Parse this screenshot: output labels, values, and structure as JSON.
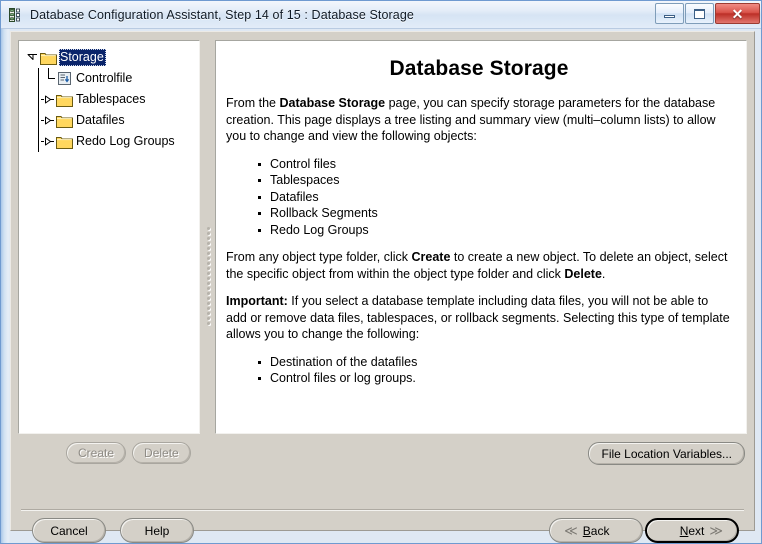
{
  "window": {
    "title": "Database Configuration Assistant, Step 14 of 15 : Database Storage",
    "icon": "database-icon",
    "controls": {
      "minimize": "minimize-icon",
      "maximize": "maximize-icon",
      "close": "✕"
    }
  },
  "tree": {
    "nodes": [
      {
        "label": "Storage",
        "icon": "folder-icon",
        "state": "expanded",
        "selected": true
      },
      {
        "label": "Controlfile",
        "icon": "controlfile-icon",
        "state": "leaf",
        "selected": false
      },
      {
        "label": "Tablespaces",
        "icon": "folder-icon",
        "state": "collapsed",
        "selected": false
      },
      {
        "label": "Datafiles",
        "icon": "folder-icon",
        "state": "collapsed",
        "selected": false
      },
      {
        "label": "Redo Log Groups",
        "icon": "folder-icon",
        "state": "collapsed",
        "selected": false
      }
    ]
  },
  "content": {
    "title": "Database Storage",
    "paragraph1_part1": "From the ",
    "paragraph1_bold": "Database Storage",
    "paragraph1_part2": " page, you can specify storage parameters for the database creation. This page displays a tree listing and summary view (multi–column lists) to allow you to change and view the following objects:",
    "object_list": [
      "Control files",
      "Tablespaces",
      "Datafiles",
      "Rollback Segments",
      "Redo Log Groups"
    ],
    "paragraph2_part1": "From any object type folder, click ",
    "paragraph2_bold1": "Create",
    "paragraph2_part2": " to create a new object. To delete an object, select the specific object from within the object type folder and click ",
    "paragraph2_bold2": "Delete",
    "paragraph2_part3": ".",
    "paragraph3_bold": "Important:",
    "paragraph3_text": " If you select a database template including data files, you will not be able to add or remove data files, tablespaces, or rollback segments. Selecting this type of template allows you to change the following:",
    "change_list": [
      "Destination of the datafiles",
      "Control files or log groups."
    ]
  },
  "buttons": {
    "create": "Create",
    "delete": "Delete",
    "file_location_variables": "File Location Variables...",
    "cancel": "Cancel",
    "help": "Help",
    "back": "ack",
    "back_mnemonic": "B",
    "next": "ext",
    "next_mnemonic": "N",
    "back_chevron": "≪",
    "next_chevron": "≫"
  },
  "colors": {
    "selection": "#0a246a",
    "dialog_face": "#d4d0c8",
    "panel": "#ffffff",
    "folder": "#ffd75e",
    "close_button": "#bc2f27"
  }
}
